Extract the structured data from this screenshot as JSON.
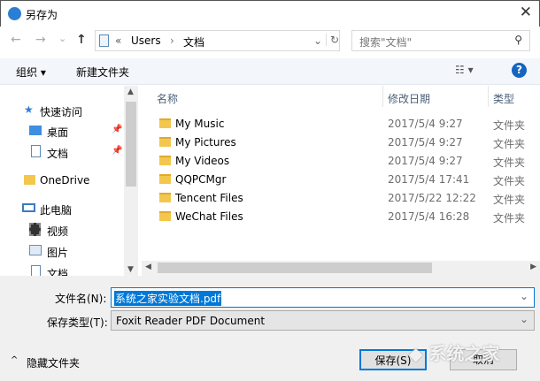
{
  "window": {
    "title": "另存为",
    "close": "✕"
  },
  "nav": {
    "back": "←",
    "forward": "→",
    "recent": "⌄",
    "up": "↑",
    "breadcrumb_prefix": "«",
    "crumbs": [
      "Users",
      "文档"
    ],
    "separator": "›",
    "dropdown": "⌄",
    "refresh": "↻",
    "search_placeholder": "搜索\"文档\"",
    "search_icon": "⚲"
  },
  "toolbar": {
    "organize": "组织 ▾",
    "new_folder": "新建文件夹",
    "view": "☷ ▾",
    "help": "?"
  },
  "sidebar": {
    "items": [
      {
        "label": "快速访问",
        "icon": "star-icon"
      },
      {
        "label": "桌面",
        "icon": "desktop-icon",
        "pinned": true
      },
      {
        "label": "文档",
        "icon": "document-icon",
        "pinned": true
      },
      {
        "label": "OneDrive",
        "icon": "folder-icon"
      },
      {
        "label": "此电脑",
        "icon": "computer-icon"
      },
      {
        "label": "视频",
        "icon": "video-icon"
      },
      {
        "label": "图片",
        "icon": "picture-icon"
      },
      {
        "label": "文档",
        "icon": "document-icon"
      }
    ]
  },
  "list": {
    "columns": {
      "name": "名称",
      "date": "修改日期",
      "type": "类型"
    },
    "rows": [
      {
        "name": "My Music",
        "date": "2017/5/4 9:27",
        "type": "文件夹"
      },
      {
        "name": "My Pictures",
        "date": "2017/5/4 9:27",
        "type": "文件夹"
      },
      {
        "name": "My Videos",
        "date": "2017/5/4 9:27",
        "type": "文件夹"
      },
      {
        "name": "QQPCMgr",
        "date": "2017/5/4 17:41",
        "type": "文件夹"
      },
      {
        "name": "Tencent Files",
        "date": "2017/5/22 12:22",
        "type": "文件夹"
      },
      {
        "name": "WeChat Files",
        "date": "2017/5/4 16:28",
        "type": "文件夹"
      }
    ]
  },
  "form": {
    "filename_label": "文件名(N):",
    "filename_value": "系统之家实验文档.pdf",
    "filetype_label": "保存类型(T):",
    "filetype_value": "Foxit Reader PDF Document"
  },
  "footer": {
    "hide_folders": "隐藏文件夹",
    "save": "保存(S)",
    "cancel": "取消"
  },
  "watermark": "系统之家"
}
